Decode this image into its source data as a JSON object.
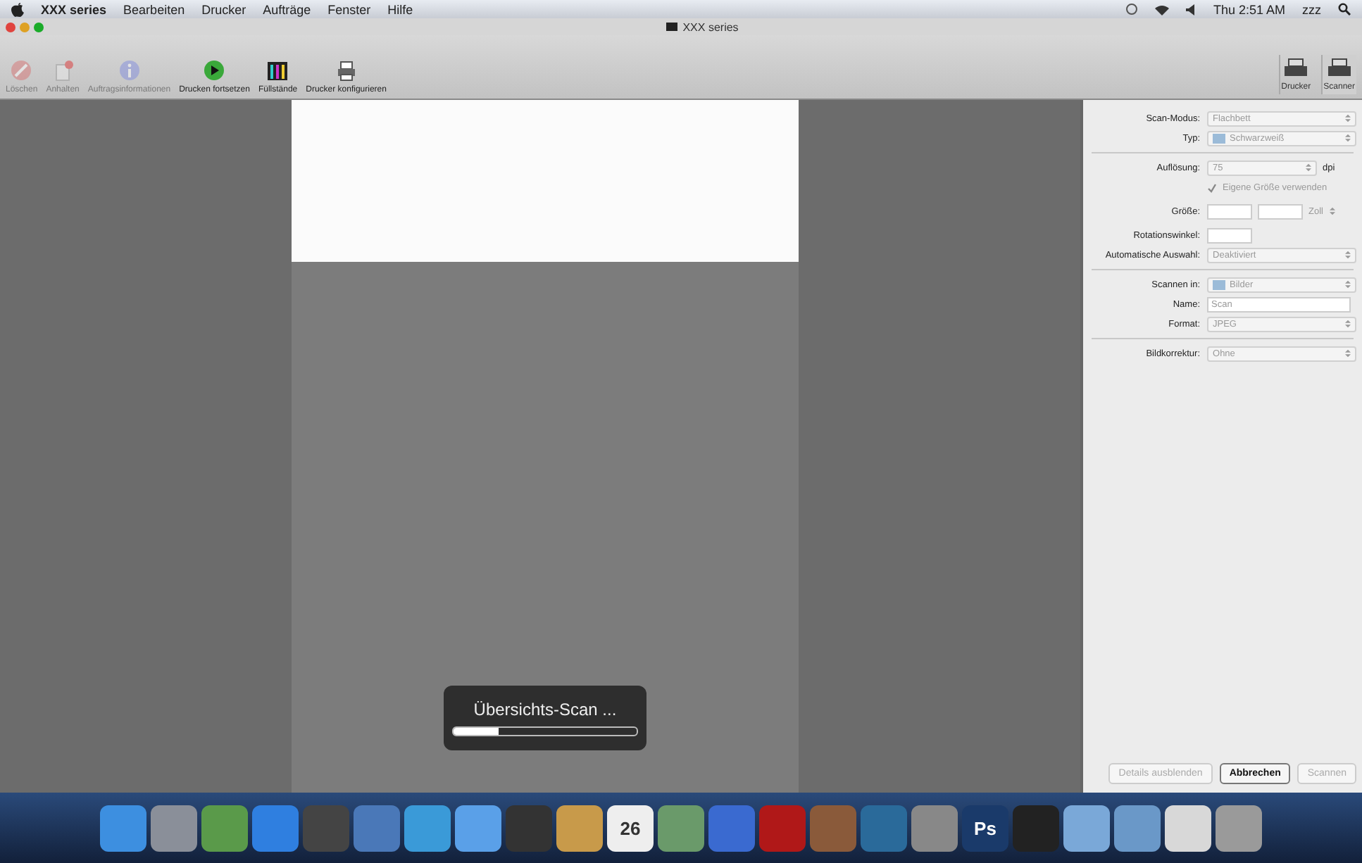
{
  "menubar": {
    "app": "XXX  series",
    "items": [
      "Bearbeiten",
      "Drucker",
      "Aufträge",
      "Fenster",
      "Hilfe"
    ],
    "clock": "Thu 2:51 AM",
    "user": "zzz"
  },
  "window": {
    "title": "XXX series"
  },
  "toolbar": [
    {
      "label": "Löschen",
      "disabled": true
    },
    {
      "label": "Anhalten",
      "disabled": true
    },
    {
      "label": "Auftragsinformationen",
      "disabled": true
    },
    {
      "label": "Drucken fortsetzen",
      "disabled": false
    },
    {
      "label": "Füllstände",
      "disabled": false
    },
    {
      "label": "Drucker konfigurieren",
      "disabled": false
    }
  ],
  "mode_tabs": [
    {
      "label": "Drucker",
      "selected": false
    },
    {
      "label": "Scanner",
      "selected": true
    }
  ],
  "progress": {
    "label": "Übersichts-Scan ...",
    "level": 0.25
  },
  "settings": [
    {
      "kind": "select",
      "label": "Scan-Modus:",
      "value": "Flachbett"
    },
    {
      "kind": "select-icon",
      "label": "Typ:",
      "value": "Schwarzweiß"
    },
    {
      "kind": "divider"
    },
    {
      "kind": "unit",
      "label": "Auflösung:",
      "value": "75",
      "unit": "dpi"
    },
    {
      "kind": "checkbox",
      "label": "Eigene Größe verwenden",
      "checked": true
    },
    {
      "kind": "size",
      "label": "Größe:",
      "unit": "Zoll"
    },
    {
      "kind": "field",
      "label": "Rotationswinkel:"
    },
    {
      "kind": "select",
      "label": "Automatische Auswahl:",
      "value": "Deaktiviert"
    },
    {
      "kind": "divider"
    },
    {
      "kind": "select-icon",
      "label": "Scannen in:",
      "value": "Bilder"
    },
    {
      "kind": "field",
      "label": "Name:",
      "value": "Scan"
    },
    {
      "kind": "select",
      "label": "Format:",
      "value": "JPEG"
    },
    {
      "kind": "divider"
    },
    {
      "kind": "select",
      "label": "Bildkorrektur:",
      "value": "Ohne"
    }
  ],
  "buttons": [
    {
      "label": "Details ausblenden",
      "disabled": true,
      "default": false
    },
    {
      "label": "Abbrechen",
      "disabled": false,
      "default": true
    },
    {
      "label": "Scannen",
      "disabled": true,
      "default": false
    }
  ],
  "dock": [
    {
      "color": "#3d8fe0"
    },
    {
      "color": "#8a8f99"
    },
    {
      "color": "#5a9a4a"
    },
    {
      "color": "#2f7fe0"
    },
    {
      "color": "#444444"
    },
    {
      "color": "#4a78b8"
    },
    {
      "color": "#3a9ad8"
    },
    {
      "color": "#5aa0e8"
    },
    {
      "color": "#333333"
    },
    {
      "color": "#c89a4a"
    },
    {
      "color": "#eeeeee",
      "label": "26"
    },
    {
      "color": "#6a9a6a"
    },
    {
      "color": "#3a6ad0"
    },
    {
      "color": "#b01818"
    },
    {
      "color": "#8a5a3a"
    },
    {
      "color": "#2a6a9a"
    },
    {
      "color": "#888888"
    },
    {
      "color": "#1a3a6a",
      "label": "Ps"
    },
    {
      "color": "#222222"
    },
    {
      "color": "#7aa8d8"
    },
    {
      "color": "#6a98c8"
    },
    {
      "color": "#d8d8d8"
    },
    {
      "color": "#9a9a9a"
    }
  ]
}
